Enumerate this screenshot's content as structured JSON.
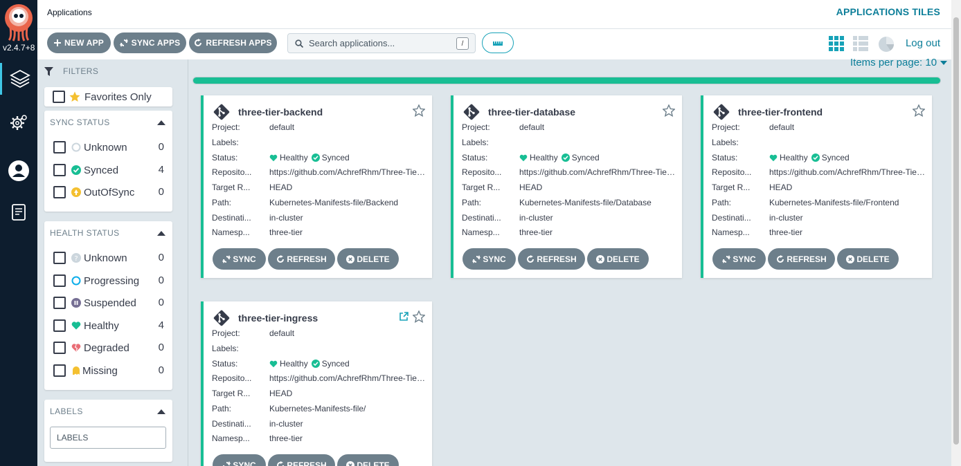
{
  "nav": {
    "version": "v2.4.7+8",
    "items": [
      "applications",
      "settings",
      "user-info",
      "documentation"
    ]
  },
  "topbar": {
    "breadcrumb": "Applications",
    "view_title": "APPLICATIONS TILES",
    "logout": "Log out"
  },
  "toolbar": {
    "new_app": "NEW APP",
    "sync_apps": "SYNC APPS",
    "refresh_apps": "REFRESH APPS",
    "search_placeholder": "Search applications...",
    "search_shortcut": "/"
  },
  "filters": {
    "title": "FILTERS",
    "favorites": "Favorites Only",
    "sync_status": {
      "title": "SYNC STATUS",
      "items": [
        {
          "label": "Unknown",
          "count": "0"
        },
        {
          "label": "Synced",
          "count": "4"
        },
        {
          "label": "OutOfSync",
          "count": "0"
        }
      ]
    },
    "health_status": {
      "title": "HEALTH STATUS",
      "items": [
        {
          "label": "Unknown",
          "count": "0"
        },
        {
          "label": "Progressing",
          "count": "0"
        },
        {
          "label": "Suspended",
          "count": "0"
        },
        {
          "label": "Healthy",
          "count": "4"
        },
        {
          "label": "Degraded",
          "count": "0"
        },
        {
          "label": "Missing",
          "count": "0"
        }
      ]
    },
    "labels": {
      "title": "LABELS",
      "placeholder": "LABELS"
    }
  },
  "pagination": {
    "items_per_page": "Items per page: 10",
    "loaded_fraction": 1.0
  },
  "field_labels": {
    "project": "Project:",
    "labels": "Labels:",
    "status": "Status:",
    "repository": "Reposito...",
    "target": "Target R...",
    "path": "Path:",
    "destination": "Destinati...",
    "namespace": "Namesp..."
  },
  "card_actions": {
    "sync": "SYNC",
    "refresh": "REFRESH",
    "delete": "DELETE"
  },
  "apps": [
    {
      "name": "three-tier-backend",
      "project": "default",
      "labels": "",
      "health": "Healthy",
      "sync": "Synced",
      "repository": "https://github.com/AchrefRhm/Three-Tier-Kubernetes-Deployment",
      "target": "HEAD",
      "path": "Kubernetes-Manifests-file/Backend",
      "destination": "in-cluster",
      "namespace": "three-tier"
    },
    {
      "name": "three-tier-database",
      "project": "default",
      "labels": "",
      "health": "Healthy",
      "sync": "Synced",
      "repository": "https://github.com/AchrefRhm/Three-Tier-Kubernetes-Deployment",
      "target": "HEAD",
      "path": "Kubernetes-Manifests-file/Database",
      "destination": "in-cluster",
      "namespace": "three-tier"
    },
    {
      "name": "three-tier-frontend",
      "project": "default",
      "labels": "",
      "health": "Healthy",
      "sync": "Synced",
      "repository": "https://github.com/AchrefRhm/Three-Tier-Kubernetes-Deployment",
      "target": "HEAD",
      "path": "Kubernetes-Manifests-file/Frontend",
      "destination": "in-cluster",
      "namespace": "three-tier"
    },
    {
      "name": "three-tier-ingress",
      "project": "default",
      "labels": "",
      "health": "Healthy",
      "sync": "Synced",
      "repository": "https://github.com/AchrefRhm/Three-Tier-Kubernetes-Deployment",
      "target": "HEAD",
      "path": "Kubernetes-Manifests-file/",
      "destination": "in-cluster",
      "namespace": "three-tier"
    }
  ],
  "colors": {
    "accent": "#0c7e99",
    "healthy": "#18be94",
    "button": "#6d7f8b",
    "nav_bg": "#0d1d2e",
    "out_of_sync": "#f4c030",
    "degraded": "#e96d76"
  }
}
